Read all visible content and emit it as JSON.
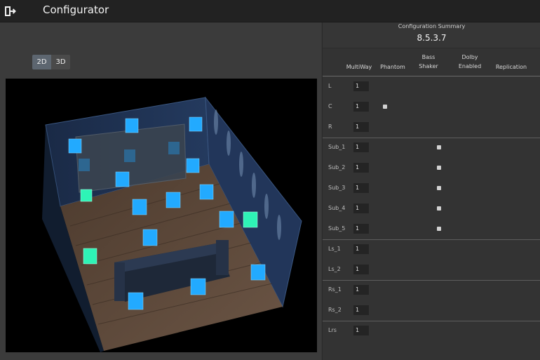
{
  "app": {
    "title": "Configurator"
  },
  "view_toggle": {
    "options": [
      "2D",
      "3D"
    ],
    "selected": "2D"
  },
  "summary": {
    "label": "Configuration Summary",
    "version": "8.5.3.7",
    "columns": [
      "MultiWay",
      "Phantom",
      "Bass Shaker",
      "Dolby Enabled",
      "Replication"
    ],
    "rows": [
      {
        "label": "L",
        "multiway": "1",
        "phantom": false,
        "bass_shaker": false
      },
      {
        "label": "C",
        "multiway": "1",
        "phantom": true,
        "bass_shaker": false
      },
      {
        "label": "R",
        "multiway": "1",
        "phantom": false,
        "bass_shaker": false
      },
      {
        "label": "Sub_1",
        "multiway": "1",
        "phantom": false,
        "bass_shaker": true
      },
      {
        "label": "Sub_2",
        "multiway": "1",
        "phantom": false,
        "bass_shaker": true
      },
      {
        "label": "Sub_3",
        "multiway": "1",
        "phantom": false,
        "bass_shaker": true
      },
      {
        "label": "Sub_4",
        "multiway": "1",
        "phantom": false,
        "bass_shaker": true
      },
      {
        "label": "Sub_5",
        "multiway": "1",
        "phantom": false,
        "bass_shaker": true
      },
      {
        "label": "Ls_1",
        "multiway": "1",
        "phantom": false,
        "bass_shaker": false
      },
      {
        "label": "Ls_2",
        "multiway": "1",
        "phantom": false,
        "bass_shaker": false
      },
      {
        "label": "Rs_1",
        "multiway": "1",
        "phantom": false,
        "bass_shaker": false
      },
      {
        "label": "Rs_2",
        "multiway": "1",
        "phantom": false,
        "bass_shaker": false
      },
      {
        "label": "Lrs",
        "multiway": "1",
        "phantom": false,
        "bass_shaker": false
      }
    ]
  },
  "colors": {
    "speaker": "#22aaff",
    "speaker_selected": "#2ef3b6",
    "wall": "#1d2f4c",
    "floor": "#5a4637"
  }
}
